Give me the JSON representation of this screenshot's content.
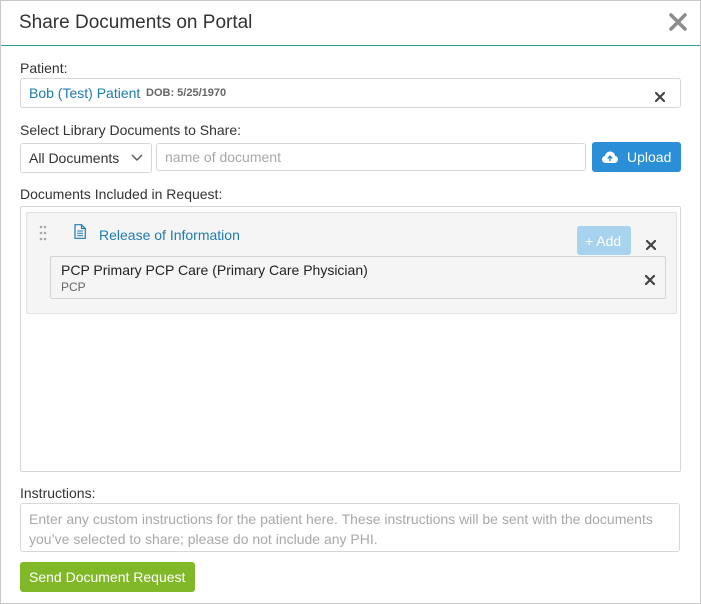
{
  "dialog": {
    "title": "Share Documents on Portal",
    "close_icon": "close-icon"
  },
  "patient": {
    "label": "Patient:",
    "name": "Bob (Test) Patient",
    "dob": "DOB: 5/25/1970",
    "clear_icon": "x-icon"
  },
  "library": {
    "label": "Select Library Documents to Share:",
    "filter_selected": "All Documents",
    "search_placeholder": "name of document",
    "upload_label": "Upload",
    "upload_icon": "cloud-upload-icon"
  },
  "documents": {
    "label": "Documents Included in Request:",
    "items": [
      {
        "title": "Release of Information",
        "add_label": "+ Add",
        "recipients": [
          {
            "name": "PCP Primary PCP Care (Primary Care Physician)",
            "code": "PCP"
          }
        ]
      }
    ]
  },
  "instructions": {
    "label": "Instructions:",
    "placeholder": "Enter any custom instructions for the patient here. These instructions will be sent with the documents you’ve selected to share; please do not include any PHI."
  },
  "submit": {
    "label": "Send Document Request"
  },
  "colors": {
    "accent_teal": "#2a9d9d",
    "link_blue": "#1f7bb0",
    "upload_blue": "#2a8fd6",
    "add_disabled": "#a8d3ef",
    "send_green": "#80b828"
  }
}
